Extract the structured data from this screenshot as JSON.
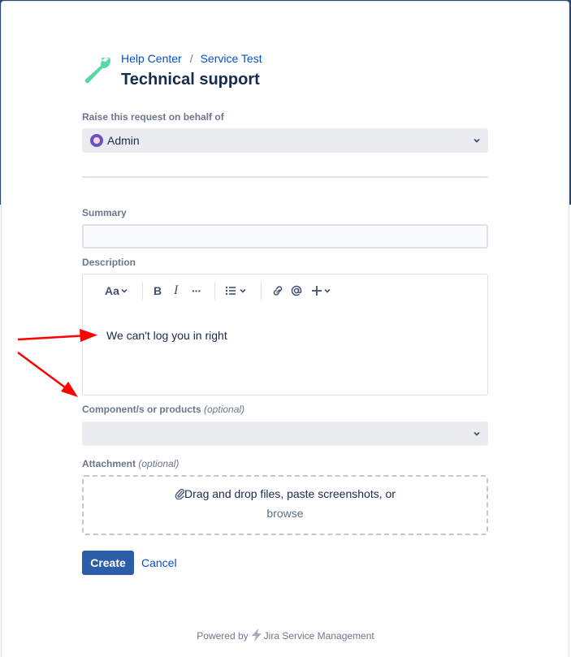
{
  "header": {
    "breadcrumbs": [
      "Help Center",
      "Service Test"
    ],
    "breadcrumb_separator": "/",
    "title": "Technical support"
  },
  "on_behalf": {
    "label": "Raise this request on behalf of",
    "value": "Admin"
  },
  "summary": {
    "label": "Summary",
    "value": ""
  },
  "description": {
    "label": "Description",
    "toolbar": {
      "text_style": "Aa",
      "bold": "B",
      "italic": "I",
      "more": "···"
    },
    "text": "We can't log you in right"
  },
  "components": {
    "label": "Component/s or products",
    "optional": "(optional)",
    "value": ""
  },
  "attachment": {
    "label": "Attachment",
    "optional": "(optional)",
    "prompt": "Drag and drop files, paste screenshots, or",
    "browse": "browse"
  },
  "actions": {
    "create": "Create",
    "cancel": "Cancel"
  },
  "footer": {
    "powered_by": "Powered by",
    "product": "Jira Service Management"
  },
  "colors": {
    "accent": "#0052cc",
    "primary_button": "#2c5ea8",
    "logo": "#57d9a3",
    "annotation_arrow": "#ff0000"
  },
  "icons": [
    "wrench-logo-icon",
    "chevron-down-icon",
    "bold-icon",
    "italic-icon",
    "more-icon",
    "bullet-list-icon",
    "link-icon",
    "mention-icon",
    "plus-icon",
    "paperclip-icon",
    "jira-logo-icon"
  ]
}
